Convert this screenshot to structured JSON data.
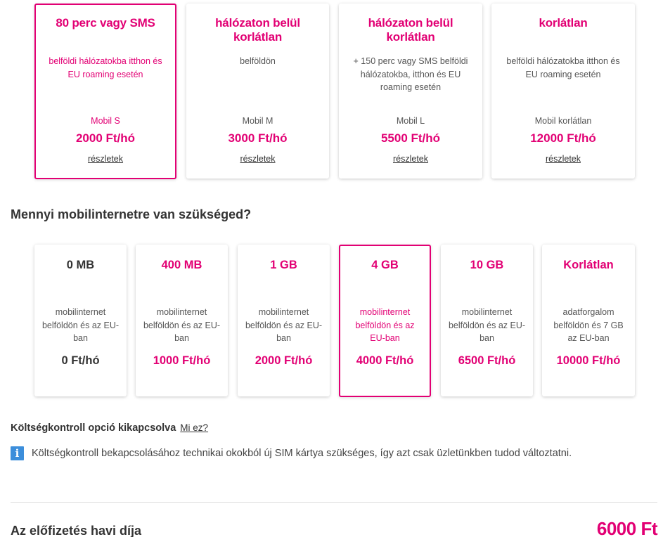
{
  "colors": {
    "accent": "#e20074",
    "info_icon": "#3c8edb"
  },
  "plans": [
    {
      "title": "80 perc vagy SMS",
      "desc": "belföldi hálózatokba itthon és EU roaming esetén",
      "name": "Mobil S",
      "price": "2000 Ft/hó",
      "link": "részletek",
      "selected": true
    },
    {
      "title": "hálózaton belül korlátlan",
      "desc": "belföldön",
      "name": "Mobil M",
      "price": "3000 Ft/hó",
      "link": "részletek",
      "selected": false
    },
    {
      "title": "hálózaton belül korlátlan",
      "desc": "+ 150 perc vagy SMS belföldi hálózatokba, itthon és EU roaming esetén",
      "name": "Mobil L",
      "price": "5500 Ft/hó",
      "link": "részletek",
      "selected": false
    },
    {
      "title": "korlátlan",
      "desc": "belföldi hálózatokba itthon és EU roaming esetén",
      "name": "Mobil korlátlan",
      "price": "12000 Ft/hó",
      "link": "részletek",
      "selected": false
    }
  ],
  "data_section": {
    "title": "Mennyi mobilinternetre van szükséged?",
    "options": [
      {
        "title": "0 MB",
        "desc": "mobilinternet belföldön és az EU-ban",
        "price": "0 Ft/hó",
        "selected": false
      },
      {
        "title": "400 MB",
        "desc": "mobilinternet belföldön és az EU-ban",
        "price": "1000 Ft/hó",
        "selected": false
      },
      {
        "title": "1 GB",
        "desc": "mobilinternet belföldön és az EU-ban",
        "price": "2000 Ft/hó",
        "selected": false
      },
      {
        "title": "4 GB",
        "desc": "mobilinternet belföldön és az EU-ban",
        "price": "4000 Ft/hó",
        "selected": true
      },
      {
        "title": "10 GB",
        "desc": "mobilinternet belföldön és az EU-ban",
        "price": "6500 Ft/hó",
        "selected": false
      },
      {
        "title": "Korlátlan",
        "desc": "adatforgalom belföldön és 7 GB az EU-ban",
        "price": "10000 Ft/hó",
        "selected": false
      }
    ]
  },
  "cost_control": {
    "label": "Költségkontroll opció kikapcsolva",
    "link": "Mi ez?",
    "info_icon": "info-icon",
    "info_glyph": "i",
    "info_text": "Költségkontroll bekapcsolásához technikai okokból új SIM kártya szükséges, így azt csak üzletünkben tudod változtatni."
  },
  "total": {
    "label": "Az előfizetés havi díja",
    "value": "6000 Ft"
  }
}
